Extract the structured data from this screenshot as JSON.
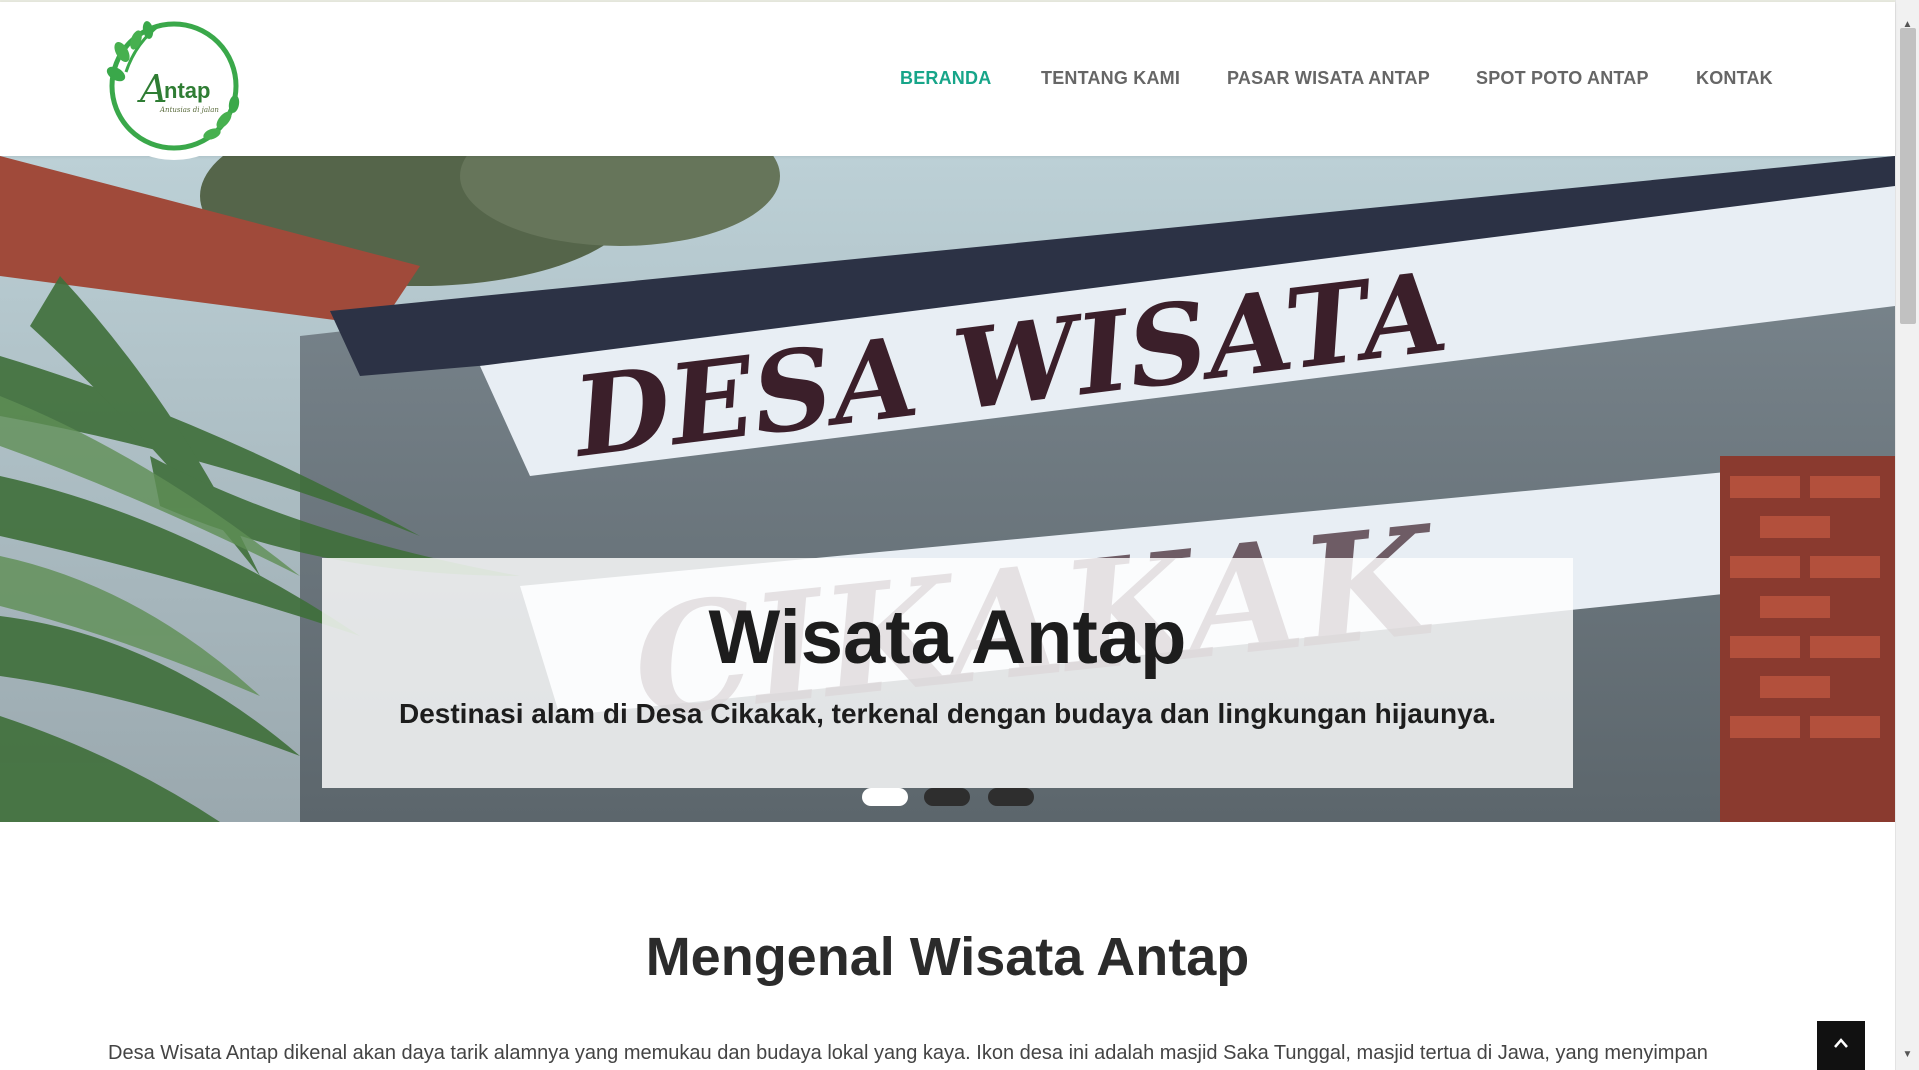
{
  "nav": {
    "items": [
      {
        "label": "BERANDA",
        "active": true
      },
      {
        "label": "TENTANG KAMI",
        "active": false
      },
      {
        "label": "PASAR WISATA ANTAP",
        "active": false
      },
      {
        "label": "SPOT POTO ANTAP",
        "active": false
      },
      {
        "label": "KONTAK",
        "active": false
      }
    ]
  },
  "logo": {
    "text": "ntap",
    "initial": "A",
    "tagline": "Antusias di jalan",
    "icon": "leaf-wreath-logo"
  },
  "hero": {
    "sign_text_top": "DESA WISATA",
    "sign_text_bottom": "CIKAKAK",
    "caption_title": "Wisata Antap",
    "caption_subtitle": "Destinasi alam di Desa Cikakak, terkenal dengan budaya dan lingkungan hijaunya.",
    "slides": 3,
    "active_slide": 1
  },
  "about": {
    "title": "Mengenal Wisata Antap",
    "text": "Desa Wisata Antap dikenal akan daya tarik alamnya yang memukau dan budaya lokal yang kaya. Ikon desa ini adalah masjid Saka Tunggal, masjid tertua di Jawa, yang menyimpan"
  },
  "colors": {
    "accent": "#17a589",
    "nav_text": "#666666",
    "heading": "#2b2b2b"
  },
  "back_to_top": {
    "icon": "chevron-up-icon"
  }
}
